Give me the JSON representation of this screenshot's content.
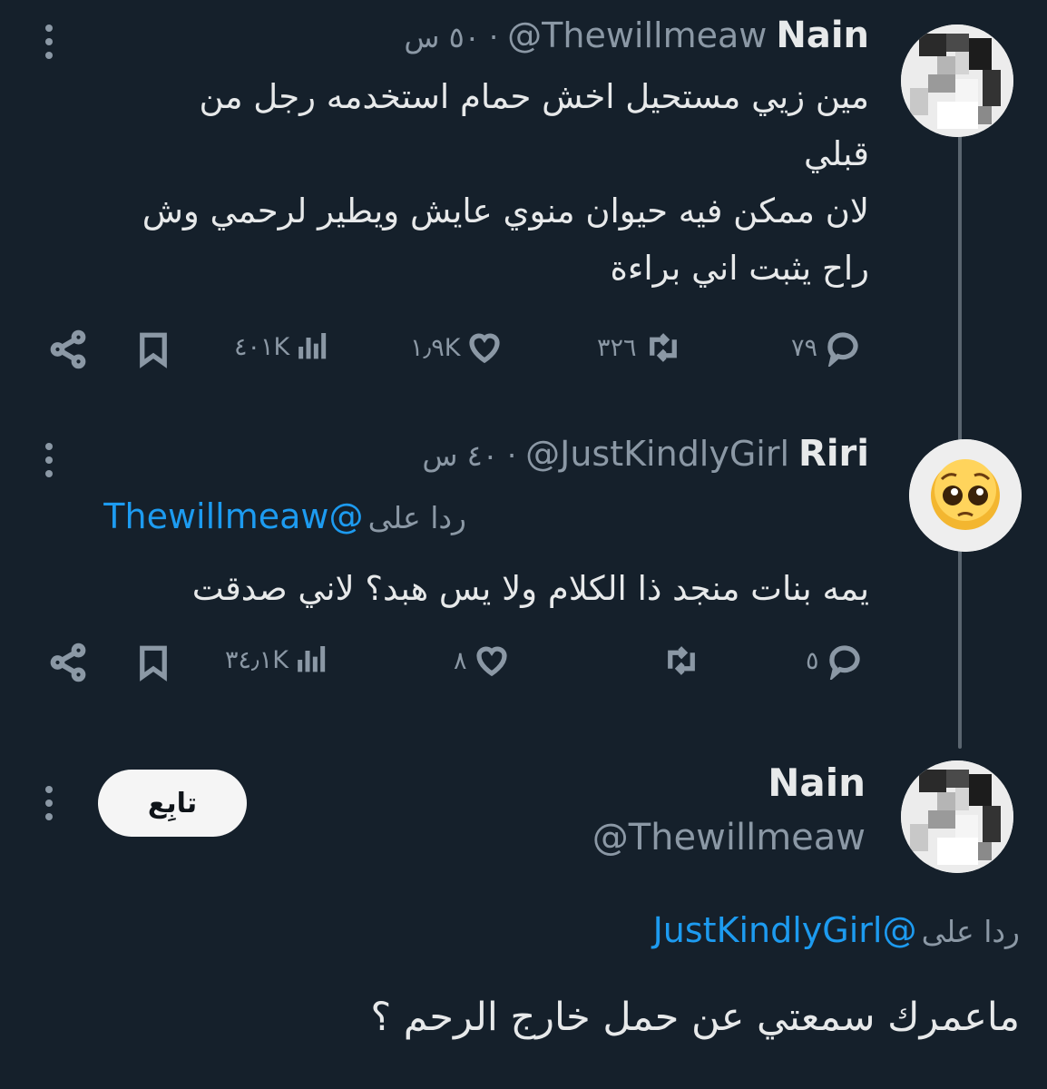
{
  "colors": {
    "background": "#15202b",
    "text": "#e7e9ea",
    "muted": "#8b98a5",
    "link": "#1d9bf0",
    "follow_bg": "#f5f5f5"
  },
  "tweet1": {
    "name": "Nain",
    "handle": "@Thewillmeaw",
    "dot": "·",
    "time": "٥٠ س",
    "lines": [
      "مين زيي مستحيل اخش حمام استخدمه رجل من",
      "قبلي",
      "لان ممكن فيه حيوان منوي عايش ويطير لرحمي وش",
      "راح يثبت اني براءة"
    ],
    "actions": {
      "replies": "٧٩",
      "retweets": "٣٢٦",
      "likes": "١٫٩K",
      "views": "٤٠١K"
    },
    "icons": [
      "reply-icon",
      "retweet-icon",
      "heart-icon",
      "views-icon",
      "bookmark-icon",
      "share-icon"
    ]
  },
  "tweet2": {
    "name": "Riri",
    "handle": "@JustKindlyGirl",
    "dot": "·",
    "time": "٤٠ س",
    "reply_label": "ردا على",
    "reply_to": "@Thewillmeaw",
    "text": "يمه بنات منجد ذا الكلام ولا يس هبد؟ لاني صدقت",
    "actions": {
      "replies": "٥",
      "retweets": "",
      "likes": "٨",
      "views": "٣٤٫١K"
    },
    "avatar": "pleading-face-emoji"
  },
  "tweet3": {
    "name": "Nain",
    "handle": "@Thewillmeaw",
    "follow_label": "تابِع",
    "reply_label": "ردا على",
    "reply_to": "@JustKindlyGirl",
    "text": "ماعمرك سمعتي عن حمل خارج الرحم ؟"
  }
}
